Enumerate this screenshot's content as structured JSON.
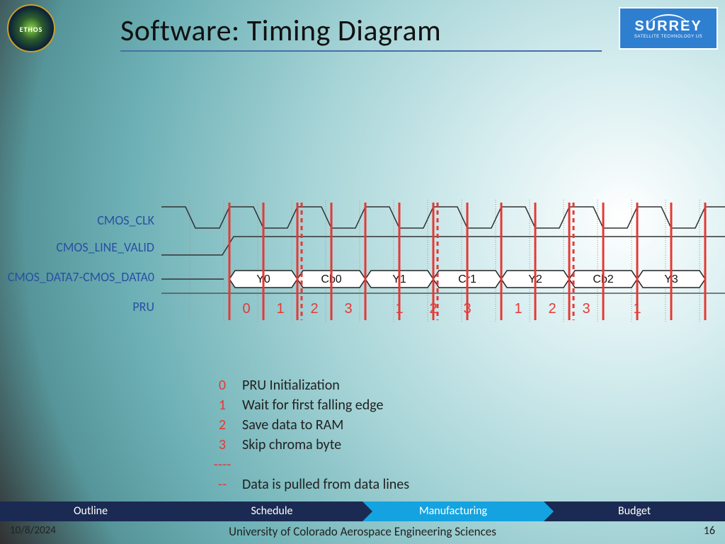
{
  "title": "Software: Timing Diagram",
  "logos": {
    "ethos": "ETHOS",
    "surrey_big": "SURREY",
    "surrey_small": "SATELLITE TECHNOLOGY US"
  },
  "signals": {
    "clk": "CMOS_CLK",
    "line": "CMOS_LINE_VALID",
    "data": "CMOS_DATA7-CMOS_DATA0",
    "pru": "PRU"
  },
  "data_bytes": [
    "Y0",
    "Cb0",
    "Y1",
    "Cr1",
    "Y2",
    "Cb2",
    "Y3"
  ],
  "pru_states": [
    "0",
    "1",
    "2",
    "3",
    "1",
    "2",
    "3",
    "1",
    "2",
    "3",
    "1"
  ],
  "legend": [
    {
      "k": "0",
      "t": "PRU Initialization"
    },
    {
      "k": "1",
      "t": "Wait for first falling edge"
    },
    {
      "k": "2",
      "t": "Save data to RAM"
    },
    {
      "k": "3",
      "t": "Skip chroma byte"
    }
  ],
  "legend_dash": "Data is pulled from data lines",
  "nav": [
    "Outline",
    "Schedule",
    "Manufacturing",
    "Budget"
  ],
  "nav_active_index": 2,
  "footer": {
    "date": "10/8/2024",
    "center": "University of Colorado Aerospace Engineering Sciences",
    "page": "16"
  },
  "chart_data": {
    "type": "timing-diagram",
    "clock_periods": 8,
    "signals": [
      {
        "name": "CMOS_CLK",
        "type": "clock",
        "periods": 8
      },
      {
        "name": "CMOS_LINE_VALID",
        "type": "level",
        "high_from_period": 0.5
      },
      {
        "name": "CMOS_DATA7-CMOS_DATA0",
        "type": "bus",
        "values": [
          "Y0",
          "Cb0",
          "Y1",
          "Cr1",
          "Y2",
          "Cb2",
          "Y3"
        ]
      },
      {
        "name": "PRU",
        "type": "label-sequence",
        "values": [
          "0",
          "1",
          "2",
          "3",
          "1",
          "2",
          "3",
          "1",
          "2",
          "3",
          "1"
        ]
      }
    ],
    "markers": {
      "solid_red_at_edges": [
        1,
        1.5,
        2,
        2.5,
        3,
        3.5,
        4,
        4.5,
        5,
        5.5,
        6,
        6.5,
        7,
        7.5,
        8
      ],
      "dashed_red_at_falling": [
        2,
        4,
        6
      ]
    }
  }
}
